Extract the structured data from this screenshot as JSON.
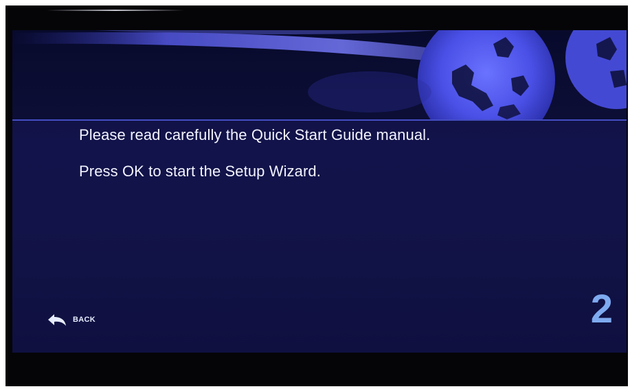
{
  "messages": {
    "line1": "Please read carefully the Quick Start Guide manual.",
    "line2": "Press OK to start the Setup Wizard."
  },
  "footer": {
    "back_label": "BACK",
    "back_icon": "back-arrow-icon",
    "step_number": "2"
  },
  "colors": {
    "background": "#12134a",
    "accent": "#4e58d8",
    "text": "#f2f3ff",
    "step_number": "#7eaaf0"
  }
}
